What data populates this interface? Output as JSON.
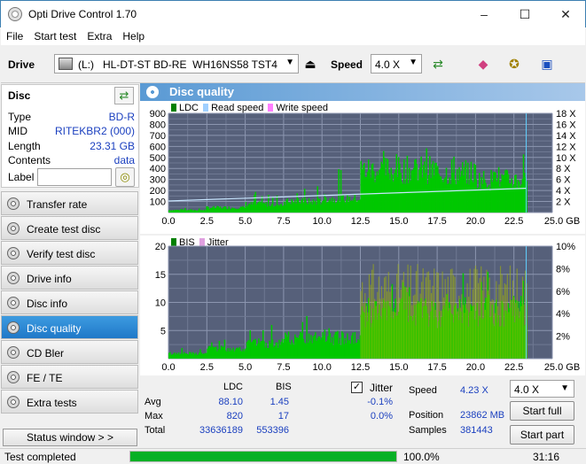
{
  "window": {
    "title": "Opti Drive Control 1.70",
    "minimize": "–",
    "maximize": "☐",
    "close": "✕"
  },
  "menu": [
    "File",
    "Start test",
    "Extra",
    "Help"
  ],
  "toolbar": {
    "drive_label": "Drive",
    "drive_value": "(L:)   HL-DT-ST BD-RE  WH16NS58 TST4",
    "speed_label": "Speed",
    "speed_value": "4.0 X"
  },
  "disc": {
    "header": "Disc",
    "rows": [
      {
        "key": "Type",
        "value": "BD-R"
      },
      {
        "key": "MID",
        "value": "RITEKBR2 (000)"
      },
      {
        "key": "Length",
        "value": "23.31 GB"
      },
      {
        "key": "Contents",
        "value": "data"
      }
    ],
    "label_key": "Label",
    "label_value": ""
  },
  "nav": [
    {
      "label": "Transfer rate",
      "active": false
    },
    {
      "label": "Create test disc",
      "active": false
    },
    {
      "label": "Verify test disc",
      "active": false
    },
    {
      "label": "Drive info",
      "active": false
    },
    {
      "label": "Disc info",
      "active": false
    },
    {
      "label": "Disc quality",
      "active": true
    },
    {
      "label": "CD Bler",
      "active": false
    },
    {
      "label": "FE / TE",
      "active": false
    },
    {
      "label": "Extra tests",
      "active": false
    }
  ],
  "status_window_btn": "Status window > >",
  "panel_title": "Disc quality",
  "chart_data": [
    {
      "type": "area",
      "legend": [
        "LDC",
        "Read speed",
        "Write speed"
      ],
      "colors": {
        "LDC": "#00c800",
        "Read speed": "#a0d0ff",
        "Write speed": "#ff80ff"
      },
      "xlim": [
        0,
        25
      ],
      "x_ticks": [
        "0.0",
        "2.5",
        "5.0",
        "7.5",
        "10.0",
        "12.5",
        "15.0",
        "17.5",
        "20.0",
        "22.5",
        "25.0 GB"
      ],
      "ylim": [
        0,
        900
      ],
      "y_ticks": [
        "900",
        "800",
        "700",
        "600",
        "500",
        "400",
        "300",
        "200",
        "100"
      ],
      "y2_ticks": [
        "18 X",
        "16 X",
        "14 X",
        "12 X",
        "10 X",
        "8 X",
        "6 X",
        "4 X",
        "2 X"
      ],
      "y2lim": [
        0,
        18
      ],
      "ldc_segments": [
        {
          "x": [
            0,
            2.5
          ],
          "base": 25,
          "spike": 60
        },
        {
          "x": [
            2.5,
            5.0
          ],
          "base": 50,
          "spike": 100
        },
        {
          "x": [
            5.0,
            7.5
          ],
          "base": 85,
          "spike": 200
        },
        {
          "x": [
            7.5,
            10.0
          ],
          "base": 110,
          "spike": 280
        },
        {
          "x": [
            10.0,
            12.5
          ],
          "base": 140,
          "spike": 430
        },
        {
          "x": [
            12.5,
            17.5
          ],
          "base": 430,
          "spike": 590
        },
        {
          "x": [
            17.5,
            20.0
          ],
          "base": 400,
          "spike": 600
        },
        {
          "x": [
            20.0,
            23.3
          ],
          "base": 330,
          "spike": 820
        }
      ],
      "read_speed": {
        "x": [
          0,
          23.3
        ],
        "y": [
          2.1,
          4.4
        ]
      },
      "end_marker_x": 23.3
    },
    {
      "type": "area",
      "legend": [
        "BIS",
        "Jitter"
      ],
      "colors": {
        "BIS": "#00c800",
        "Jitter": "#e0a0e0"
      },
      "xlim": [
        0,
        25
      ],
      "x_ticks": [
        "0.0",
        "2.5",
        "5.0",
        "7.5",
        "10.0",
        "12.5",
        "15.0",
        "17.5",
        "20.0",
        "22.5",
        "25.0 GB"
      ],
      "ylim": [
        0,
        20
      ],
      "y_ticks": [
        "20",
        "15",
        "10",
        "5"
      ],
      "y2_ticks": [
        "10%",
        "8%",
        "6%",
        "4%",
        "2%"
      ],
      "y2lim": [
        0,
        10
      ],
      "bis_segments": [
        {
          "x": [
            0,
            2.5
          ],
          "base": 1,
          "spike": 2
        },
        {
          "x": [
            2.5,
            5.0
          ],
          "base": 2,
          "spike": 4
        },
        {
          "x": [
            5.0,
            7.5
          ],
          "base": 3,
          "spike": 6
        },
        {
          "x": [
            7.5,
            10.0
          ],
          "base": 4,
          "spike": 8
        },
        {
          "x": [
            10.0,
            12.5
          ],
          "base": 4,
          "spike": 6
        },
        {
          "x": [
            12.5,
            23.3
          ],
          "base": 9,
          "spike": 17
        }
      ],
      "end_marker_x": 23.3
    }
  ],
  "stats": {
    "headers": {
      "ldc": "LDC",
      "bis": "BIS"
    },
    "rows": [
      {
        "label": "Avg",
        "ldc": "88.10",
        "bis": "1.45",
        "jitter": "-0.1%"
      },
      {
        "label": "Max",
        "ldc": "820",
        "bis": "17",
        "jitter": "0.0%"
      },
      {
        "label": "Total",
        "ldc": "33636189",
        "bis": "553396",
        "jitter": ""
      }
    ],
    "jitter_label": "Jitter",
    "jitter_check": "✓",
    "speed_label": "Speed",
    "speed_value": "4.23 X",
    "position_label": "Position",
    "position_value": "23862 MB",
    "samples_label": "Samples",
    "samples_value": "381443",
    "speed_select": "4.0 X",
    "start_full": "Start full",
    "start_part": "Start part"
  },
  "statusbar": {
    "text": "Test completed",
    "progress": 1.0,
    "percent": "100.0%",
    "time": "31:16"
  }
}
